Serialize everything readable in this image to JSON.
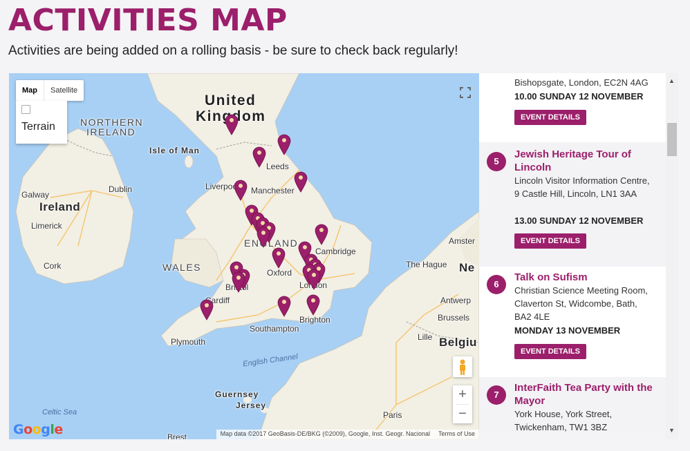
{
  "page": {
    "title": "ACTIVITIES MAP",
    "intro": "Activities are being added on a rolling basis - be sure to check back regularly!"
  },
  "map": {
    "type_buttons": [
      "Map",
      "Satellite"
    ],
    "terrain_label": "Terrain",
    "labels": {
      "united": "United",
      "kingdom": "Kingdom",
      "northern": "NORTHERN",
      "ireland_ni": "IRELAND",
      "isle_of_man": "Isle of Man",
      "ireland": "Ireland",
      "dublin": "Dublin",
      "galway": "Galway",
      "limerick": "Limerick",
      "cork": "Cork",
      "leeds": "Leeds",
      "liverpool": "Liverpool",
      "manchester": "Manchester",
      "england": "ENGLAND",
      "wales": "WALES",
      "cambridge": "Cambridge",
      "oxford": "Oxford",
      "bristol": "Bristol",
      "cardiff": "Cardiff",
      "london": "London",
      "southampton": "Southampton",
      "brighton": "Brighton",
      "plymouth": "Plymouth",
      "english_channel": "English Channel",
      "guernsey": "Guernsey",
      "jersey": "Jersey",
      "celtic_sea": "Celtic Sea",
      "amsterdam": "Amster",
      "the_hague": "The Hague",
      "ne": "Ne",
      "antwerp": "Antwerp",
      "brussels": "Brussels",
      "lille": "Lille",
      "belgium": "Belgiu",
      "paris": "Paris",
      "brest": "Brest"
    },
    "google_logo": [
      "G",
      "o",
      "o",
      "g",
      "l",
      "e"
    ],
    "google_colors": [
      "#4285f4",
      "#ea4335",
      "#fbbc05",
      "#4285f4",
      "#34a853",
      "#ea4335"
    ],
    "attribution": "Map data ©2017 GeoBasis-DE/BKG (©2009), Google, Inst. Geogr. Nacional",
    "terms": "Terms of Use",
    "zoom_in": "+",
    "zoom_out": "−",
    "pin_color": "#9b1f6a",
    "pin_count": 24
  },
  "events": [
    {
      "address": "Bishopsgate, London, EC2N 4AG",
      "when": "10.00 SUNDAY 12 NOVEMBER",
      "details_label": "EVENT DETAILS"
    },
    {
      "number": "5",
      "title": "Jewish Heritage Tour of Lincoln",
      "address": "Lincoln Visitor Information Centre, 9 Castle Hill, Lincoln, LN1 3AA",
      "when": "13.00 SUNDAY 12 NOVEMBER",
      "details_label": "EVENT DETAILS"
    },
    {
      "number": "6",
      "title": "Talk on Sufism",
      "address": "Christian Science Meeting Room, Claverton St, Widcombe, Bath, BA2 4LE",
      "when": "MONDAY 13 NOVEMBER",
      "details_label": "EVENT DETAILS"
    },
    {
      "number": "7",
      "title": "InterFaith Tea Party with the Mayor",
      "address": "York House, York Street, Twickenham, TW1 3BZ"
    }
  ],
  "colors": {
    "brand": "#9b1f6a",
    "sea": "#a8d0f5",
    "land": "#f2efe4"
  }
}
